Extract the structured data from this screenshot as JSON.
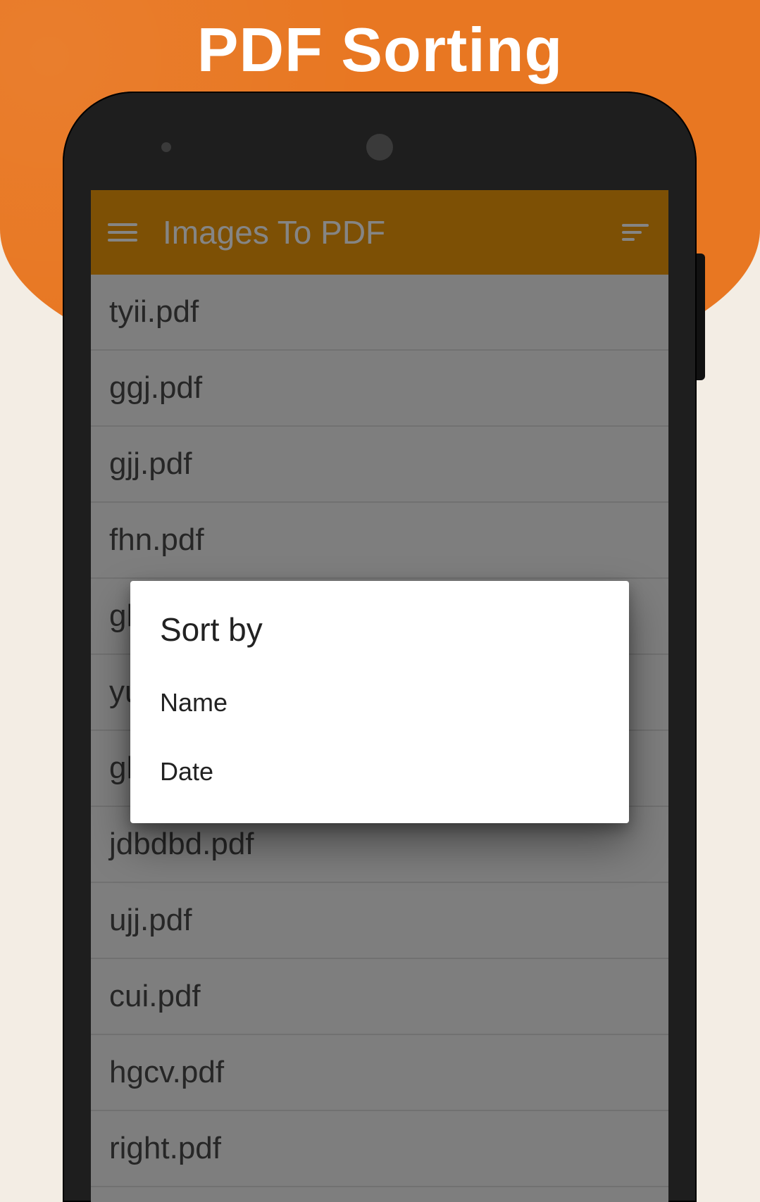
{
  "marketing": {
    "title": "PDF Sorting"
  },
  "appbar": {
    "title": "Images To PDF"
  },
  "files": [
    {
      "name": "tyii.pdf"
    },
    {
      "name": "ggj.pdf"
    },
    {
      "name": "gjj.pdf"
    },
    {
      "name": "fhn.pdf"
    },
    {
      "name": "gh"
    },
    {
      "name": "yu"
    },
    {
      "name": "gh"
    },
    {
      "name": "jdbdbd.pdf"
    },
    {
      "name": "ujj.pdf"
    },
    {
      "name": "cui.pdf"
    },
    {
      "name": "hgcv.pdf"
    },
    {
      "name": "right.pdf"
    }
  ],
  "dialog": {
    "title": "Sort by",
    "options": [
      {
        "label": "Name"
      },
      {
        "label": "Date"
      }
    ]
  }
}
